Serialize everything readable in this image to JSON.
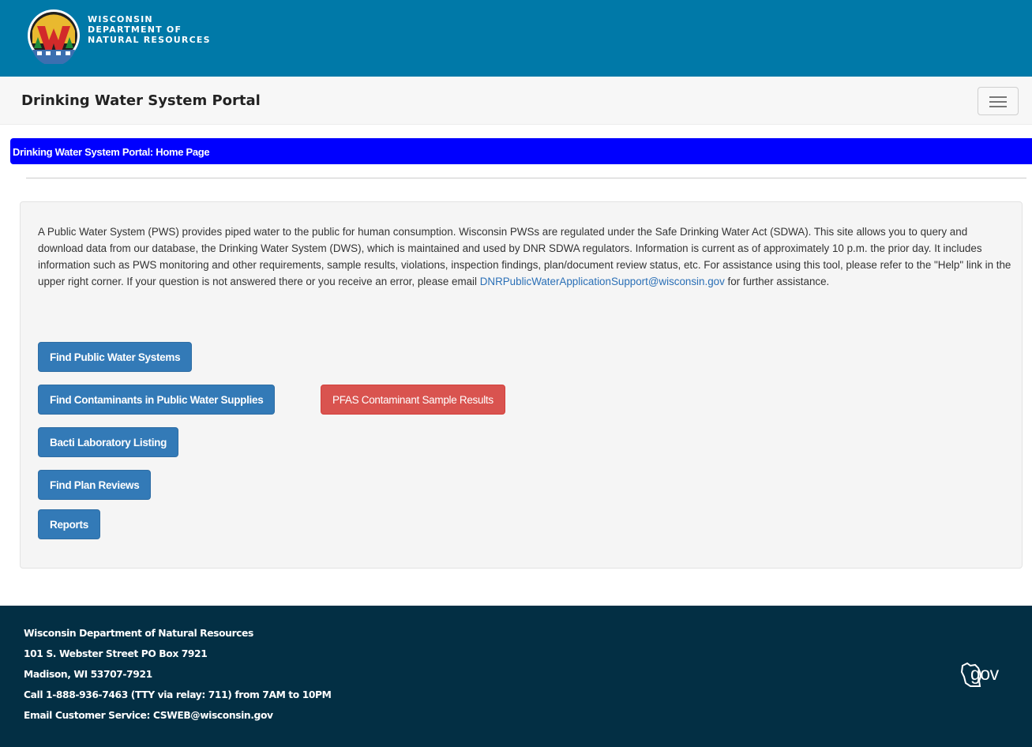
{
  "header": {
    "logo_line1": "WISCONSIN",
    "logo_line2": "DEPARTMENT OF",
    "logo_line3": "NATURAL RESOURCES",
    "logo_letter": "W"
  },
  "navbar": {
    "title": "Drinking Water System Portal",
    "menu_icon": "hamburger-icon"
  },
  "breadcrumb": {
    "text": "Drinking Water System Portal: Home Page"
  },
  "intro": {
    "text_before_email": "A Public Water System (PWS) provides piped water to the public for human consumption. Wisconsin PWSs are regulated under the Safe Drinking Water Act (SDWA). This site allows you to query and download data from our database, the Drinking Water System (DWS), which is maintained and used by DNR SDWA regulators. Information is current as of approximately 10 p.m. the prior day. It includes information such as PWS monitoring and other requirements, sample results, violations, inspection findings, plan/document review status, etc. For assistance using this tool, please refer to the \"Help\" link in the upper right corner. If your question is not answered there or you receive an error, please email ",
    "email": "DNRPublicWaterApplicationSupport@wisconsin.gov",
    "text_after_email": " for further assistance."
  },
  "buttons": {
    "find_pws": "Find Public Water Systems",
    "find_contaminants": "Find Contaminants in Public Water Supplies",
    "pfas": "PFAS Contaminant Sample Results",
    "bacti": "Bacti Laboratory Listing",
    "plan_reviews": "Find Plan Reviews",
    "reports": "Reports"
  },
  "footer": {
    "org": "Wisconsin Department of Natural Resources",
    "address1": "101 S. Webster Street PO Box 7921",
    "address2": "Madison, WI 53707-7921",
    "phone": "Call 1-888-936-7463 (TTY via relay: 711) from 7AM to 10PM",
    "email": "Email Customer Service: CSWEB@wisconsin.gov",
    "gov_logo_text": "gov"
  },
  "colors": {
    "header_bg": "#0079a8",
    "breadcrumb_bg": "#0000ff",
    "primary_button": "#337ab7",
    "danger_button": "#d9534f",
    "footer_bg": "#032f44",
    "link": "#2a6fb6"
  }
}
